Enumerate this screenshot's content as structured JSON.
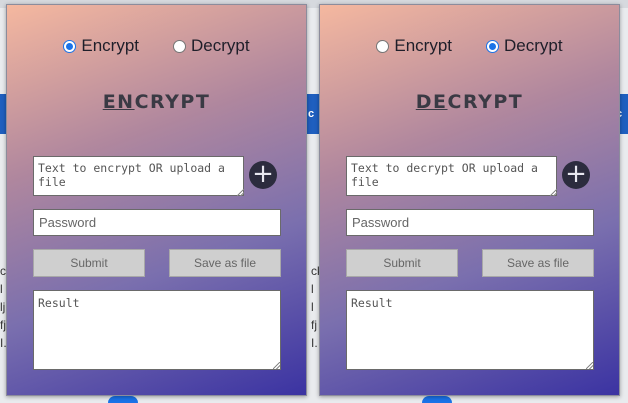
{
  "background": {
    "left_fragment": "c",
    "text_column_left": [
      "ck",
      "l",
      "lj",
      "fj",
      "I."
    ],
    "text_column_mid": [
      "ck",
      "l",
      "l",
      "fj",
      "I."
    ]
  },
  "colors": {
    "gradient_start": "#f5b89f",
    "gradient_end": "#3b33a2",
    "radio_accent": "#1a73e8",
    "plus_button": "#2c2c3e"
  },
  "popups": [
    {
      "mode_encrypt_label": "Encrypt",
      "mode_decrypt_label": "Decrypt",
      "selected_mode": "Encrypt",
      "heading_prefix": "EN",
      "heading_rest": "CRYPT",
      "text_placeholder": "Text to encrypt OR upload a file",
      "upload_icon": "plus-icon",
      "password_placeholder": "Password",
      "submit_label": "Submit",
      "save_label": "Save as file",
      "result_placeholder": "Result"
    },
    {
      "mode_encrypt_label": "Encrypt",
      "mode_decrypt_label": "Decrypt",
      "selected_mode": "Decrypt",
      "heading_prefix": "DE",
      "heading_rest": "CRYPT",
      "text_placeholder": "Text to decrypt OR upload a file",
      "upload_icon": "plus-icon",
      "password_placeholder": "Password",
      "submit_label": "Submit",
      "save_label": "Save as file",
      "result_placeholder": "Result"
    }
  ]
}
